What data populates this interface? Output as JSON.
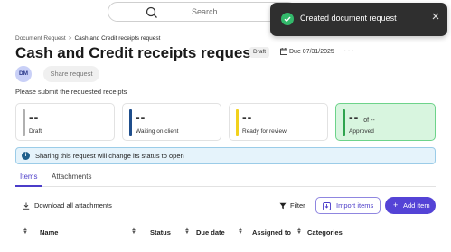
{
  "search": {
    "placeholder": "Search"
  },
  "toast": {
    "message": "Created document request"
  },
  "breadcrumb": {
    "parent": "Document Request",
    "separator": ">",
    "current": "Cash and Credit receipts request"
  },
  "header": {
    "title": "Cash and Credit receipts request",
    "status_badge": "Draft",
    "due": "Due 07/31/2025",
    "more": "···"
  },
  "avatar": {
    "initials": "DM"
  },
  "share_button": "Share request",
  "instructions": "Please submit the requested receipts",
  "cards": [
    {
      "value": "--",
      "label": "Draft",
      "color": "#b0b0b0"
    },
    {
      "value": "--",
      "label": "Waiting on client",
      "color": "#1f4e8c"
    },
    {
      "value": "--",
      "label": "Ready for review",
      "color": "#f2d11c"
    },
    {
      "value": "--",
      "of_text": "of --",
      "label": "Approved",
      "color": "#2fa44f"
    }
  ],
  "banner": {
    "icon": "i",
    "text": "Sharing this request will change its status to open"
  },
  "tabs": [
    {
      "label": "Items"
    },
    {
      "label": "Attachments"
    }
  ],
  "toolbar": {
    "download_all": "Download all attachments",
    "filter": "Filter",
    "import": "Import items",
    "add": "Add item"
  },
  "table": {
    "columns": [
      "Name",
      "Status",
      "Due date",
      "Assigned to",
      "Categories"
    ]
  },
  "colors": {
    "accent": "#5443d6",
    "toast_bg": "#2f2f2f",
    "success": "#33b96b",
    "banner_bg": "#e5f3fb",
    "approved_bg": "#d8f5df"
  }
}
